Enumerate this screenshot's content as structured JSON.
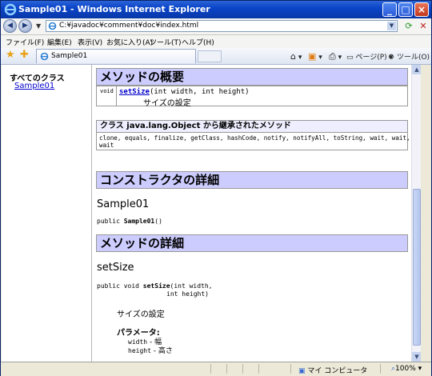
{
  "window": {
    "title": "Sample01 - Windows Internet Explorer"
  },
  "address": {
    "url": "C:¥javadoc¥comment¥doc¥index.html"
  },
  "menu": [
    "ファイル(F)",
    "編集(E)",
    "表示(V)",
    "お気に入り(A)",
    "ツール(T)",
    "ヘルプ(H)"
  ],
  "tab": {
    "label": "Sample01"
  },
  "commands": {
    "page": "ページ(P)",
    "tools": "ツール(O)"
  },
  "left_frame": {
    "heading": "すべてのクラス",
    "class_link": "Sample01"
  },
  "doc": {
    "method_summary_title": "メソッドの概要",
    "summary_modifier": "void",
    "summary_method_link": "setSize",
    "summary_params": "(int width, int height)",
    "summary_desc": "サイズの設定",
    "inherited_title": "クラス java.lang.Object から継承されたメソッド",
    "inherited_line1": "clone, equals, finalize, getClass, hashCode, notify, notifyAll, toString, wait, wait,",
    "inherited_line2": "wait",
    "constructor_detail_title": "コンストラクタの詳細",
    "constructor_name": "Sample01",
    "constructor_sig_prefix": "public ",
    "constructor_sig_name": "Sample01",
    "constructor_sig_suffix": "()",
    "method_detail_title": "メソッドの詳細",
    "method_name": "setSize",
    "method_sig_prefix": "public void ",
    "method_sig_name": "setSize",
    "method_sig_line1_suffix": "(int width,",
    "method_sig_line2": "int height)",
    "method_desc": "サイズの設定",
    "params_label": "パラメータ:",
    "param1_name": "width",
    "param1_desc": " - 幅",
    "param2_name": "height",
    "param2_desc": " - 高さ"
  },
  "status": {
    "zone": "マイ コンピュータ",
    "zoom": "100%"
  },
  "icons": {
    "back": "back-arrow-icon",
    "forward": "forward-arrow-icon",
    "refresh": "refresh-icon",
    "stop": "stop-x-icon",
    "favorites": "favorites-star-icon",
    "add_favorites": "add-favorites-icon",
    "home": "home-icon",
    "feeds": "feeds-icon",
    "print": "print-icon"
  }
}
